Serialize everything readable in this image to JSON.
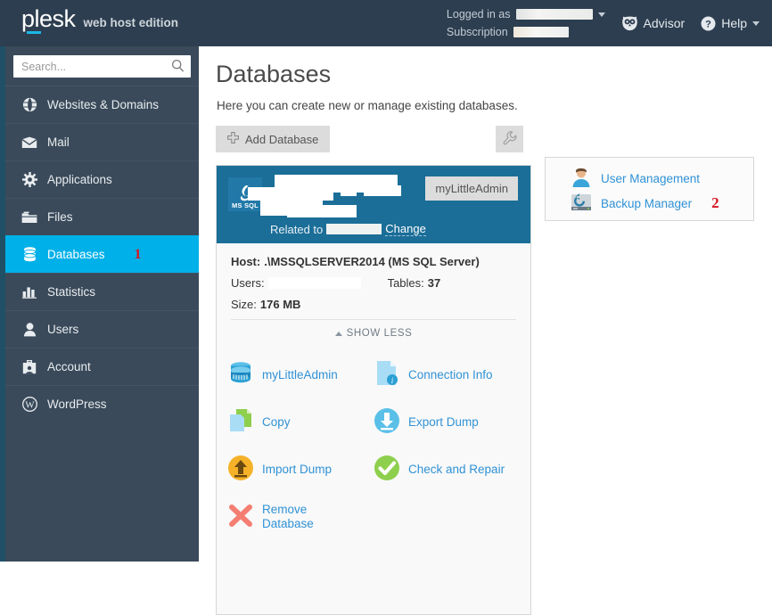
{
  "topbar": {
    "brand": "plesk",
    "edition": "web host edition",
    "logged_in_label": "Logged in as",
    "logged_in_user": "",
    "subscription_label": "Subscription",
    "subscription_value": "",
    "advisor_label": "Advisor",
    "advisor_icon": "owl-icon",
    "help_label": "Help",
    "help_icon": "question-circle-icon",
    "caret_icon": "chevron-down-icon"
  },
  "sidebar": {
    "search_placeholder": "Search...",
    "search_value": "",
    "search_icon": "search-icon",
    "items": [
      {
        "label": "Websites & Domains",
        "icon": "globe-icon",
        "active": false,
        "annotation": ""
      },
      {
        "label": "Mail",
        "icon": "envelope-icon",
        "active": false,
        "annotation": ""
      },
      {
        "label": "Applications",
        "icon": "gear-icon",
        "active": false,
        "annotation": ""
      },
      {
        "label": "Files",
        "icon": "folder-icon",
        "active": false,
        "annotation": ""
      },
      {
        "label": "Databases",
        "icon": "database-icon",
        "active": true,
        "annotation": "1"
      },
      {
        "label": "Statistics",
        "icon": "bar-chart-icon",
        "active": false,
        "annotation": ""
      },
      {
        "label": "Users",
        "icon": "user-icon",
        "active": false,
        "annotation": ""
      },
      {
        "label": "Account",
        "icon": "briefcase-icon",
        "active": false,
        "annotation": ""
      },
      {
        "label": "WordPress",
        "icon": "wordpress-icon",
        "active": false,
        "annotation": ""
      }
    ]
  },
  "main": {
    "title": "Databases",
    "subtitle": "Here you can create new or manage existing databases.",
    "add_button": "Add Database",
    "add_button_icon": "plus-icon",
    "tools_button_icon": "wrench-icon"
  },
  "database_card": {
    "db_type_logo": "MS SQL",
    "db_name": "",
    "admin_button": "myLittleAdmin",
    "related_label": "Related to",
    "related_value": "",
    "change_link": "Change",
    "host_label": "Host:",
    "host_value": ".\\MSSQLSERVER2014 (MS SQL Server)",
    "users_label": "Users:",
    "users_value": "",
    "tables_label": "Tables:",
    "tables_value": "37",
    "size_label": "Size:",
    "size_value": "176 MB",
    "show_less": "SHOW LESS",
    "show_less_icon": "chevron-up-icon",
    "actions": [
      {
        "label": "myLittleAdmin",
        "icon": "database-cylinder-icon"
      },
      {
        "label": "Connection Info",
        "icon": "document-info-icon"
      },
      {
        "label": "Copy",
        "icon": "copy-pages-icon"
      },
      {
        "label": "Export Dump",
        "icon": "download-circle-icon"
      },
      {
        "label": "Import Dump",
        "icon": "upload-circle-icon"
      },
      {
        "label": "Check and Repair",
        "icon": "check-circle-icon"
      },
      {
        "label": "Remove Database",
        "icon": "red-x-icon"
      }
    ]
  },
  "side_panel": {
    "items": [
      {
        "label": "User Management",
        "icon": "user-avatar-icon",
        "annotation": ""
      },
      {
        "label": "Backup Manager",
        "icon": "backup-restore-icon",
        "annotation": "2"
      }
    ]
  },
  "colors": {
    "topbar_bg": "#2d3e50",
    "sidebar_bg": "#3a4a5a",
    "active_item": "#00b0e8",
    "card_header": "#1b6e98",
    "link_blue": "#3092d6",
    "annotation_red": "#d81522"
  }
}
